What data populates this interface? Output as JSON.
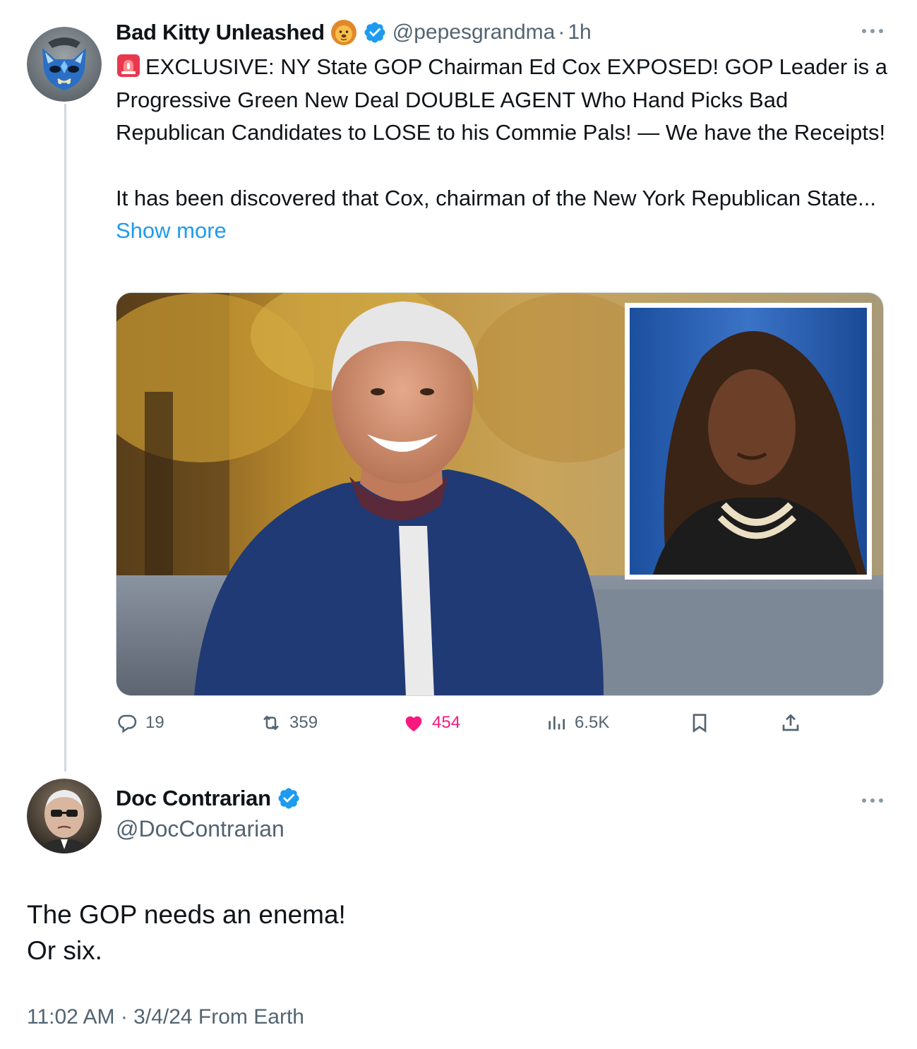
{
  "colors": {
    "text": "#0f1419",
    "secondary": "#536471",
    "link": "#1d9bf0",
    "like": "#f91880",
    "verified": "#1d9bf0",
    "thread_line": "#cfd9de"
  },
  "tweet1": {
    "display_name": "Bad Kitty Unleashed",
    "name_emoji": "lion-face-icon",
    "handle": "@pepesgrandma",
    "separator": "·",
    "time": "1h",
    "text_line1": "EXCLUSIVE: NY State GOP Chairman Ed Cox EXPOSED! GOP Leader is a Progressive Green New Deal DOUBLE AGENT Who Hand Picks Bad Republican Candidates to LOSE to his Commie Pals! — We have the Receipts!",
    "text_line2": "It has been discovered that Cox, chairman of the New York Republican State...",
    "show_more": "Show more",
    "stats": {
      "replies": "19",
      "reposts": "359",
      "likes": "454",
      "views": "6.5K"
    }
  },
  "tweet2": {
    "display_name": "Doc Contrarian",
    "handle": "@DocContrarian",
    "text_line1": "The GOP needs an enema!",
    "text_line2": "Or six.",
    "footer": "11:02 AM · 3/4/24 From Earth"
  }
}
